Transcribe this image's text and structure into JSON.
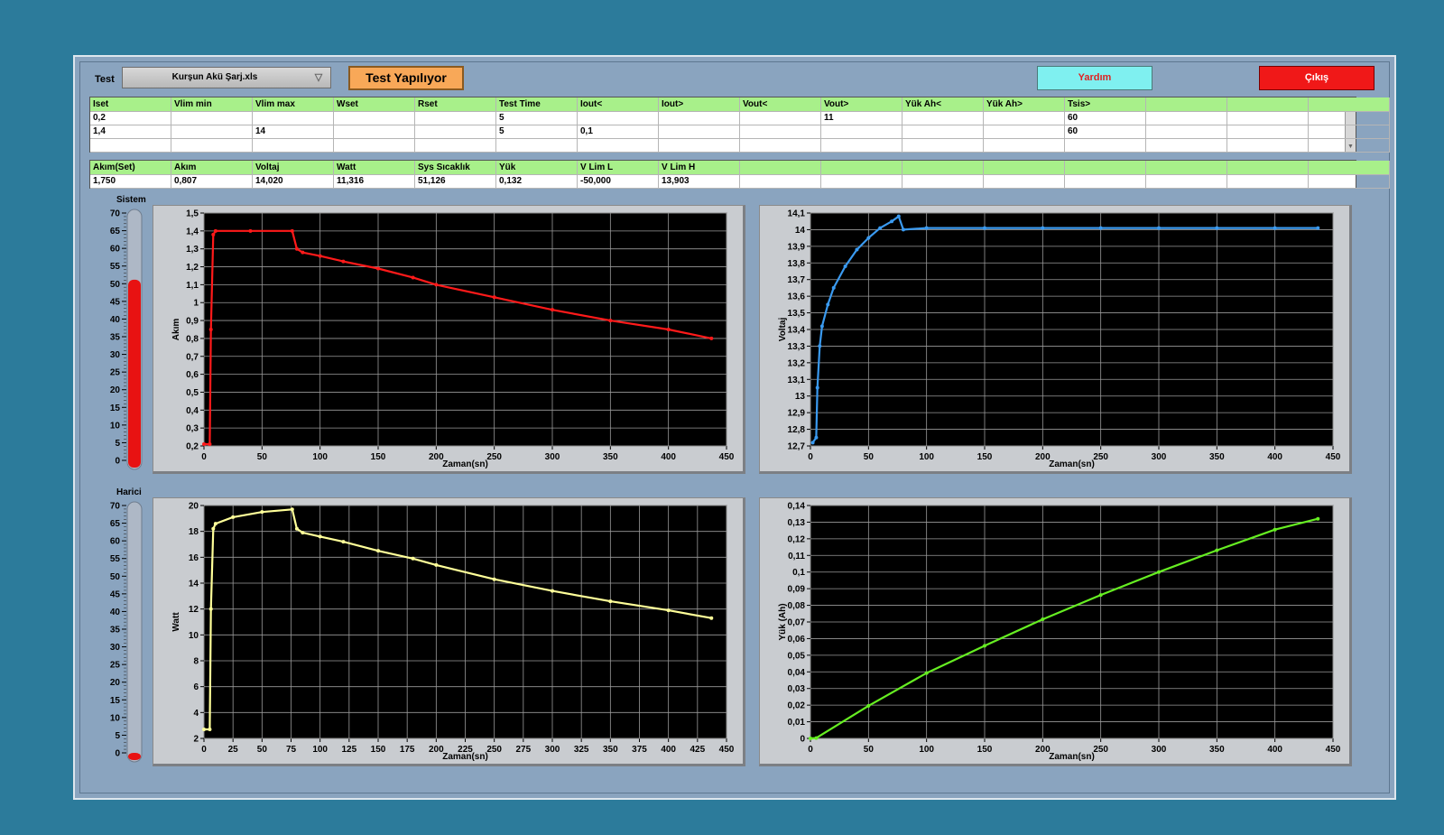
{
  "toolbar": {
    "test_label": "Test",
    "file_select": "Kurşun Akü Şarj.xls",
    "status_button": "Test Yapılıyor",
    "help_button": "Yardım",
    "exit_button": "Çıkış"
  },
  "settings_table": {
    "headers": [
      "Iset",
      "Vlim min",
      "Vlim max",
      "Wset",
      "Rset",
      "Test Time",
      "Iout<",
      "Iout>",
      "Vout<",
      "Vout>",
      "Yük Ah<",
      "Yük Ah>",
      "Tsis>",
      "",
      "",
      ""
    ],
    "rows": [
      [
        "0,2",
        "",
        "",
        "",
        "",
        "5",
        "",
        "",
        "",
        "11",
        "",
        "",
        "60",
        "",
        "",
        ""
      ],
      [
        "1,4",
        "",
        "14",
        "",
        "",
        "5",
        "0,1",
        "",
        "",
        "",
        "",
        "",
        "60",
        "",
        "",
        ""
      ],
      [
        "",
        "",
        "",
        "",
        "",
        "",
        "",
        "",
        "",
        "",
        "",
        "",
        "",
        "",
        "",
        ""
      ]
    ]
  },
  "measure_table": {
    "headers": [
      "Akım(Set)",
      "Akım",
      "Voltaj",
      "Watt",
      "Sys Sıcaklık",
      "Yük",
      "V Lim L",
      "V Lim H",
      "",
      "",
      "",
      "",
      "",
      "",
      "",
      ""
    ],
    "rows": [
      [
        "1,750",
        "0,807",
        "14,020",
        "11,316",
        "51,126",
        "0,132",
        "-50,000",
        "13,903",
        "",
        "",
        "",
        "",
        "",
        "",
        "",
        ""
      ]
    ]
  },
  "thermometers": [
    {
      "title": "Sistem",
      "value": 51.126,
      "min": 0,
      "max": 70,
      "ticks": [
        "70",
        "65",
        "60",
        "55",
        "50",
        "45",
        "40",
        "35",
        "30",
        "25",
        "20",
        "15",
        "10",
        "5",
        "0"
      ]
    },
    {
      "title": "Harici",
      "value": 0,
      "min": 0,
      "max": 70,
      "ticks": [
        "70",
        "65",
        "60",
        "55",
        "50",
        "45",
        "40",
        "35",
        "30",
        "25",
        "20",
        "15",
        "10",
        "5",
        "0"
      ]
    }
  ],
  "colors": {
    "current": "#ff1a1a",
    "voltage": "#3a9af0",
    "watt": "#ffff99",
    "charge": "#66ee22",
    "header_green": "#a8f08a",
    "panel": "#8aa4bf"
  },
  "chart_data": [
    {
      "type": "line",
      "ylabel": "Akım",
      "xlabel": "Zaman(sn)",
      "xlim": [
        0,
        450
      ],
      "ylim": [
        0.2,
        1.5
      ],
      "xticks": [
        "0",
        "50",
        "100",
        "150",
        "200",
        "250",
        "300",
        "350",
        "400",
        "450"
      ],
      "yticks": [
        "0,2",
        "0,3",
        "0,4",
        "0,5",
        "0,6",
        "0,7",
        "0,8",
        "0,9",
        "1",
        "1,1",
        "1,2",
        "1,3",
        "1,4",
        "1,5"
      ],
      "grid": true,
      "color": "#ff1a1a",
      "x": [
        0,
        5,
        6,
        8,
        10,
        40,
        76,
        80,
        85,
        100,
        120,
        150,
        180,
        200,
        250,
        300,
        350,
        400,
        437
      ],
      "y": [
        0.21,
        0.21,
        0.85,
        1.38,
        1.4,
        1.4,
        1.4,
        1.3,
        1.28,
        1.26,
        1.23,
        1.19,
        1.14,
        1.1,
        1.03,
        0.96,
        0.9,
        0.85,
        0.8
      ]
    },
    {
      "type": "line",
      "ylabel": "Voltaj",
      "xlabel": "Zaman(sn)",
      "xlim": [
        0,
        450
      ],
      "ylim": [
        12.7,
        14.1
      ],
      "xticks": [
        "0",
        "50",
        "100",
        "150",
        "200",
        "250",
        "300",
        "350",
        "400",
        "450"
      ],
      "yticks": [
        "12,7",
        "12,8",
        "12,9",
        "13",
        "13,1",
        "13,2",
        "13,3",
        "13,4",
        "13,5",
        "13,6",
        "13,7",
        "13,8",
        "13,9",
        "14",
        "14,1"
      ],
      "grid": true,
      "color": "#3a9af0",
      "x": [
        2,
        5,
        6,
        8,
        10,
        15,
        20,
        30,
        40,
        50,
        60,
        70,
        76,
        80,
        100,
        150,
        200,
        250,
        300,
        350,
        400,
        437
      ],
      "y": [
        12.72,
        12.75,
        13.05,
        13.3,
        13.42,
        13.55,
        13.65,
        13.78,
        13.88,
        13.95,
        14.01,
        14.05,
        14.08,
        14.0,
        14.01,
        14.01,
        14.01,
        14.01,
        14.01,
        14.01,
        14.01,
        14.01
      ]
    },
    {
      "type": "line",
      "ylabel": "Watt",
      "xlabel": "Zaman(sn)",
      "xlim": [
        0,
        450
      ],
      "ylim": [
        2,
        20
      ],
      "xticks": [
        "0",
        "25",
        "50",
        "75",
        "100",
        "125",
        "150",
        "175",
        "200",
        "225",
        "250",
        "275",
        "300",
        "325",
        "350",
        "375",
        "400",
        "425",
        "450"
      ],
      "yticks": [
        "2",
        "4",
        "6",
        "8",
        "10",
        "12",
        "14",
        "16",
        "18",
        "20"
      ],
      "grid": true,
      "color": "#ffff99",
      "x": [
        0,
        5,
        6,
        8,
        10,
        25,
        50,
        76,
        80,
        85,
        100,
        120,
        150,
        180,
        200,
        250,
        300,
        350,
        400,
        437
      ],
      "y": [
        2.7,
        2.7,
        12,
        18.2,
        18.6,
        19.1,
        19.5,
        19.7,
        18.2,
        17.9,
        17.6,
        17.2,
        16.5,
        15.9,
        15.4,
        14.3,
        13.4,
        12.6,
        11.9,
        11.3
      ]
    },
    {
      "type": "line",
      "ylabel": "Yük (Ah)",
      "xlabel": "Zaman(sn)",
      "xlim": [
        0,
        450
      ],
      "ylim": [
        0,
        0.14
      ],
      "xticks": [
        "0",
        "50",
        "100",
        "150",
        "200",
        "250",
        "300",
        "350",
        "400",
        "450"
      ],
      "yticks": [
        "0",
        "0,01",
        "0,02",
        "0,03",
        "0,04",
        "0,05",
        "0,06",
        "0,07",
        "0,08",
        "0,09",
        "0,1",
        "0,11",
        "0,12",
        "0,13",
        "0,14"
      ],
      "grid": true,
      "color": "#66ee22",
      "x": [
        0,
        5,
        50,
        100,
        150,
        200,
        250,
        300,
        350,
        400,
        437
      ],
      "y": [
        0,
        0.0002,
        0.0196,
        0.0393,
        0.0557,
        0.0716,
        0.0862,
        0.1,
        0.1131,
        0.1255,
        0.132
      ]
    }
  ]
}
